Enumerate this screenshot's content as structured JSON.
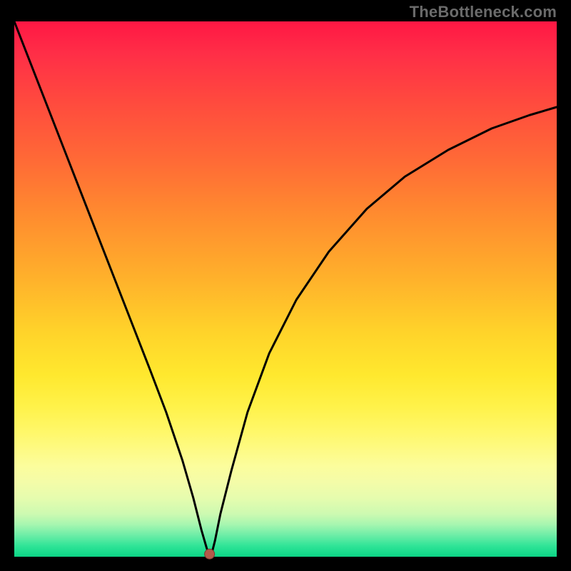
{
  "watermark": "TheBottleneck.com",
  "chart_data": {
    "type": "line",
    "title": "",
    "xlabel": "",
    "ylabel": "",
    "xlim": [
      0,
      100
    ],
    "ylim": [
      0,
      100
    ],
    "grid": false,
    "legend": "none",
    "description": "V-shaped bottleneck curve over a vertical rainbow heat gradient (red at top = high bottleneck, green at bottom = low bottleneck). Minimum (optimal point) marked with a dot.",
    "series": [
      {
        "name": "bottleneck-curve",
        "x": [
          0,
          5,
          10,
          15,
          20,
          25,
          28,
          31,
          33,
          34.5,
          35.5,
          36,
          36.5,
          37,
          38,
          40,
          43,
          47,
          52,
          58,
          65,
          72,
          80,
          88,
          95,
          100
        ],
        "y": [
          100,
          87,
          74,
          61,
          48,
          35,
          27,
          18,
          11,
          5,
          1.5,
          0.5,
          1,
          3,
          8,
          16,
          27,
          38,
          48,
          57,
          65,
          71,
          76,
          80,
          82.5,
          84
        ]
      }
    ],
    "optimal_point": {
      "x": 36,
      "y": 0.5
    },
    "gradient_stops_pct": {
      "red": 0,
      "orange": 40,
      "yellow": 70,
      "green": 100
    }
  }
}
